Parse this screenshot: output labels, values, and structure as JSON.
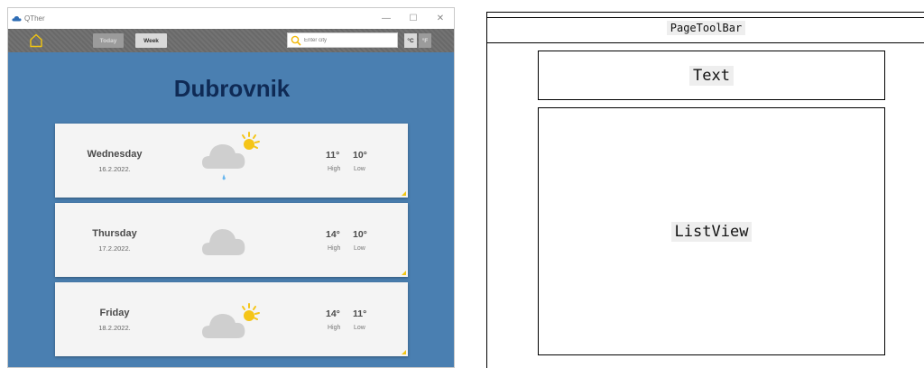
{
  "window": {
    "title": "QTher",
    "controls": {
      "minimize": "—",
      "maximize": "☐",
      "close": "✕"
    }
  },
  "toolbar": {
    "today_label": "Today",
    "week_label": "Week",
    "search_placeholder": "Enter city",
    "unit_c": "°C",
    "unit_f": "°F"
  },
  "city": "Dubrovnik",
  "forecast": [
    {
      "day": "Wednesday",
      "date": "16.2.2022.",
      "icon": "sun-cloud-rain-icon",
      "high": "11°",
      "low": "10°",
      "high_label": "High",
      "low_label": "Low"
    },
    {
      "day": "Thursday",
      "date": "17.2.2022.",
      "icon": "cloud-icon",
      "high": "14°",
      "low": "10°",
      "high_label": "High",
      "low_label": "Low"
    },
    {
      "day": "Friday",
      "date": "18.2.2022.",
      "icon": "sun-cloud-icon",
      "high": "14°",
      "low": "11°",
      "high_label": "High",
      "low_label": "Low"
    }
  ],
  "diagram": {
    "toolbar_label": "PageToolBar",
    "text_label": "Text",
    "list_label": "ListView"
  },
  "colors": {
    "window_background": "#4a7fb1",
    "toolbar": "#6d6d6d",
    "city_text": "#0f2a55",
    "card": "#f4f4f4",
    "sun": "#f5c518"
  }
}
